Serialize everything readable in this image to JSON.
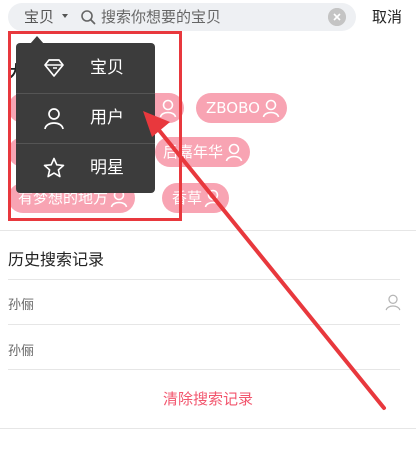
{
  "search": {
    "scope_label": "宝贝",
    "placeholder": "搜索你想要的宝贝",
    "cancel_label": "取消"
  },
  "hot_search": {
    "title_visible": "大",
    "tags": [
      {
        "text": "",
        "has_user_icon": true
      },
      {
        "text": "ZBOBO",
        "has_user_icon": true
      },
      {
        "text": "",
        "has_user_icon": false
      },
      {
        "text": "后嘉年华",
        "has_user_icon": true
      },
      {
        "text": "有梦想的地方",
        "has_user_icon": true
      },
      {
        "text": "香草",
        "has_user_icon": true
      }
    ]
  },
  "dropdown": {
    "items": [
      {
        "label": "宝贝",
        "icon": "diamond-icon"
      },
      {
        "label": "用户",
        "icon": "user-icon"
      },
      {
        "label": "明星",
        "icon": "star-icon"
      }
    ]
  },
  "history": {
    "title": "历史搜索记录",
    "items": [
      "孙俪",
      "孙俪"
    ],
    "clear_label": "清除搜索记录"
  },
  "colors": {
    "tag_bg": "#f8a4b3",
    "accent_red": "#f2556d",
    "annotation_red": "#e8383d",
    "dropdown_bg": "#3c3c3c"
  }
}
